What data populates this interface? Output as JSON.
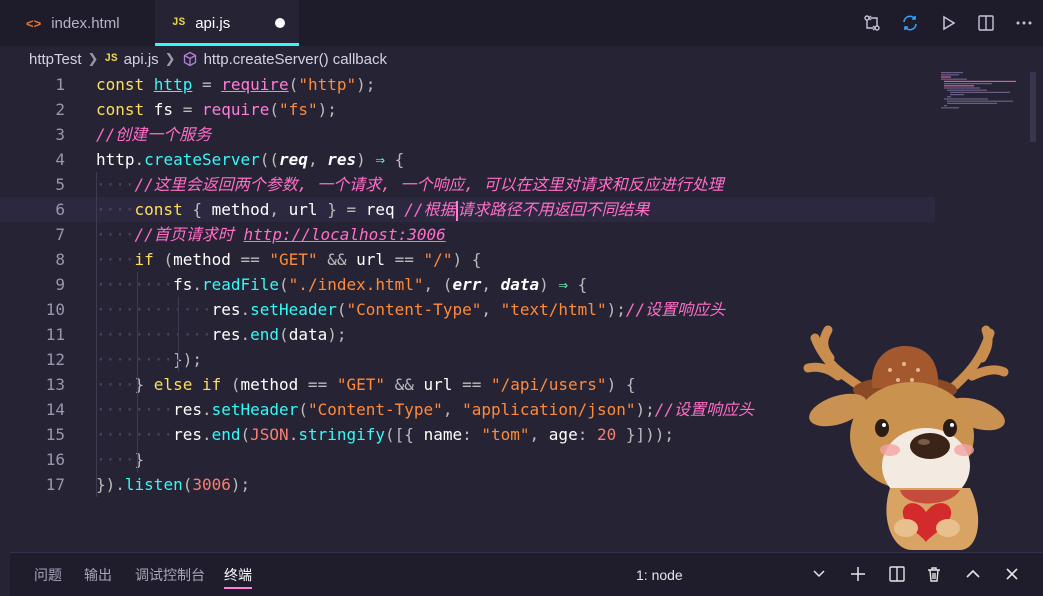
{
  "tabs": [
    {
      "label": "index.html",
      "icon": "html-file-icon",
      "icon_glyph": "<>"
    },
    {
      "label": "api.js",
      "icon": "js-file-icon",
      "icon_glyph": "JS",
      "active": true,
      "unsaved": true
    }
  ],
  "toolbar": [
    "git-compare-icon",
    "sync-icon",
    "run-icon",
    "split-editor-icon",
    "more-icon"
  ],
  "breadcrumb": {
    "folder": "httpTest",
    "file": "api.js",
    "file_glyph": "JS",
    "symbol": "http.createServer() callback"
  },
  "code": {
    "lines": [
      [
        {
          "t": "const ",
          "c": "k"
        },
        {
          "t": "http",
          "c": "fn",
          "u": true
        },
        {
          "t": " = ",
          "c": "p"
        },
        {
          "t": "require",
          "c": "vf",
          "u": true
        },
        {
          "t": "(",
          "c": "p"
        },
        {
          "t": "\"http\"",
          "c": "s"
        },
        {
          "t": ");",
          "c": "p"
        }
      ],
      [
        {
          "t": "const ",
          "c": "k"
        },
        {
          "t": "fs",
          "c": "v"
        },
        {
          "t": " = ",
          "c": "p"
        },
        {
          "t": "require",
          "c": "vf"
        },
        {
          "t": "(",
          "c": "p"
        },
        {
          "t": "\"fs\"",
          "c": "s"
        },
        {
          "t": ");",
          "c": "p"
        }
      ],
      [
        {
          "t": "//创建一个服务",
          "c": "c"
        }
      ],
      [
        {
          "t": "http",
          "c": "v"
        },
        {
          "t": ".",
          "c": "p"
        },
        {
          "t": "createServer",
          "c": "fn"
        },
        {
          "t": "((",
          "c": "p"
        },
        {
          "t": "req",
          "c": "pm"
        },
        {
          "t": ", ",
          "c": "p"
        },
        {
          "t": "res",
          "c": "pm"
        },
        {
          "t": ") ",
          "c": "p"
        },
        {
          "t": "⇒",
          "c": "ar"
        },
        {
          "t": " {",
          "c": "p"
        }
      ],
      [
        {
          "t": "····",
          "c": "dot"
        },
        {
          "t": "//这里会返回两个参数, 一个请求, 一个响应, 可以在这里对请求和反应进行处理",
          "c": "c"
        }
      ],
      [
        {
          "t": "····",
          "c": "dot"
        },
        {
          "t": "const ",
          "c": "k"
        },
        {
          "t": "{ ",
          "c": "p"
        },
        {
          "t": "method",
          "c": "v"
        },
        {
          "t": ", ",
          "c": "p"
        },
        {
          "t": "url",
          "c": "v"
        },
        {
          "t": " } = ",
          "c": "p"
        },
        {
          "t": "req",
          "c": "v"
        },
        {
          "t": " //根据",
          "c": "c"
        },
        {
          "t": "|",
          "c": "cursor"
        },
        {
          "t": "请求路径不用返回不同结果",
          "c": "c"
        }
      ],
      [
        {
          "t": "····",
          "c": "dot"
        },
        {
          "t": "//首页请求时 ",
          "c": "c"
        },
        {
          "t": "http://localhost:3006",
          "c": "c",
          "u": true
        }
      ],
      [
        {
          "t": "····",
          "c": "dot"
        },
        {
          "t": "if ",
          "c": "k"
        },
        {
          "t": "(",
          "c": "p"
        },
        {
          "t": "method",
          "c": "v"
        },
        {
          "t": " == ",
          "c": "p"
        },
        {
          "t": "\"GET\"",
          "c": "s"
        },
        {
          "t": " && ",
          "c": "p"
        },
        {
          "t": "url",
          "c": "v"
        },
        {
          "t": " == ",
          "c": "p"
        },
        {
          "t": "\"/\"",
          "c": "s"
        },
        {
          "t": ") {",
          "c": "p"
        }
      ],
      [
        {
          "t": "········",
          "c": "dot"
        },
        {
          "t": "fs",
          "c": "v"
        },
        {
          "t": ".",
          "c": "p"
        },
        {
          "t": "readFile",
          "c": "fn"
        },
        {
          "t": "(",
          "c": "p"
        },
        {
          "t": "\"./index.html\"",
          "c": "s"
        },
        {
          "t": ", (",
          "c": "p"
        },
        {
          "t": "err",
          "c": "pm"
        },
        {
          "t": ", ",
          "c": "p"
        },
        {
          "t": "data",
          "c": "pm"
        },
        {
          "t": ") ",
          "c": "p"
        },
        {
          "t": "⇒",
          "c": "ar"
        },
        {
          "t": " {",
          "c": "p"
        }
      ],
      [
        {
          "t": "············",
          "c": "dot"
        },
        {
          "t": "res",
          "c": "v"
        },
        {
          "t": ".",
          "c": "p"
        },
        {
          "t": "setHeader",
          "c": "fn"
        },
        {
          "t": "(",
          "c": "p"
        },
        {
          "t": "\"Content-Type\"",
          "c": "s"
        },
        {
          "t": ", ",
          "c": "p"
        },
        {
          "t": "\"text/html\"",
          "c": "s"
        },
        {
          "t": ");",
          "c": "p"
        },
        {
          "t": "//设置响应头",
          "c": "c"
        }
      ],
      [
        {
          "t": "············",
          "c": "dot"
        },
        {
          "t": "res",
          "c": "v"
        },
        {
          "t": ".",
          "c": "p"
        },
        {
          "t": "end",
          "c": "fn"
        },
        {
          "t": "(",
          "c": "p"
        },
        {
          "t": "data",
          "c": "v"
        },
        {
          "t": ");",
          "c": "p"
        }
      ],
      [
        {
          "t": "········",
          "c": "dot"
        },
        {
          "t": "});",
          "c": "p"
        }
      ],
      [
        {
          "t": "····",
          "c": "dot"
        },
        {
          "t": "} ",
          "c": "p"
        },
        {
          "t": "else if ",
          "c": "k"
        },
        {
          "t": "(",
          "c": "p"
        },
        {
          "t": "method",
          "c": "v"
        },
        {
          "t": " == ",
          "c": "p"
        },
        {
          "t": "\"GET\"",
          "c": "s"
        },
        {
          "t": " && ",
          "c": "p"
        },
        {
          "t": "url",
          "c": "v"
        },
        {
          "t": " == ",
          "c": "p"
        },
        {
          "t": "\"/api/users\"",
          "c": "s"
        },
        {
          "t": ") {",
          "c": "p"
        }
      ],
      [
        {
          "t": "········",
          "c": "dot"
        },
        {
          "t": "res",
          "c": "v"
        },
        {
          "t": ".",
          "c": "p"
        },
        {
          "t": "setHeader",
          "c": "fn"
        },
        {
          "t": "(",
          "c": "p"
        },
        {
          "t": "\"Content-Type\"",
          "c": "s"
        },
        {
          "t": ", ",
          "c": "p"
        },
        {
          "t": "\"application/json\"",
          "c": "s"
        },
        {
          "t": ");",
          "c": "p"
        },
        {
          "t": "//设置响应头",
          "c": "c"
        }
      ],
      [
        {
          "t": "········",
          "c": "dot"
        },
        {
          "t": "res",
          "c": "v"
        },
        {
          "t": ".",
          "c": "p"
        },
        {
          "t": "end",
          "c": "fn"
        },
        {
          "t": "(",
          "c": "p"
        },
        {
          "t": "JSON",
          "c": "n"
        },
        {
          "t": ".",
          "c": "p"
        },
        {
          "t": "stringify",
          "c": "fn"
        },
        {
          "t": "([{ ",
          "c": "p"
        },
        {
          "t": "name",
          "c": "v"
        },
        {
          "t": ": ",
          "c": "p"
        },
        {
          "t": "\"tom\"",
          "c": "s"
        },
        {
          "t": ", ",
          "c": "p"
        },
        {
          "t": "age",
          "c": "v"
        },
        {
          "t": ": ",
          "c": "p"
        },
        {
          "t": "20",
          "c": "n"
        },
        {
          "t": " }]));",
          "c": "p"
        }
      ],
      [
        {
          "t": "····",
          "c": "dot"
        },
        {
          "t": "}",
          "c": "p"
        }
      ],
      [
        {
          "t": "})",
          "c": "p"
        },
        {
          "t": ".",
          "c": "p"
        },
        {
          "t": "listen",
          "c": "fn"
        },
        {
          "t": "(",
          "c": "p"
        },
        {
          "t": "3006",
          "c": "n"
        },
        {
          "t": ");",
          "c": "p"
        }
      ]
    ],
    "current_line": 6
  },
  "panel": {
    "tabs": [
      "问题",
      "输出",
      "调试控制台",
      "终端"
    ],
    "active_tab": 3,
    "terminal_select": "1: node"
  },
  "colors": {
    "accent": "#36f9f6",
    "highlight": "#ff7edb",
    "background": "#262335"
  }
}
